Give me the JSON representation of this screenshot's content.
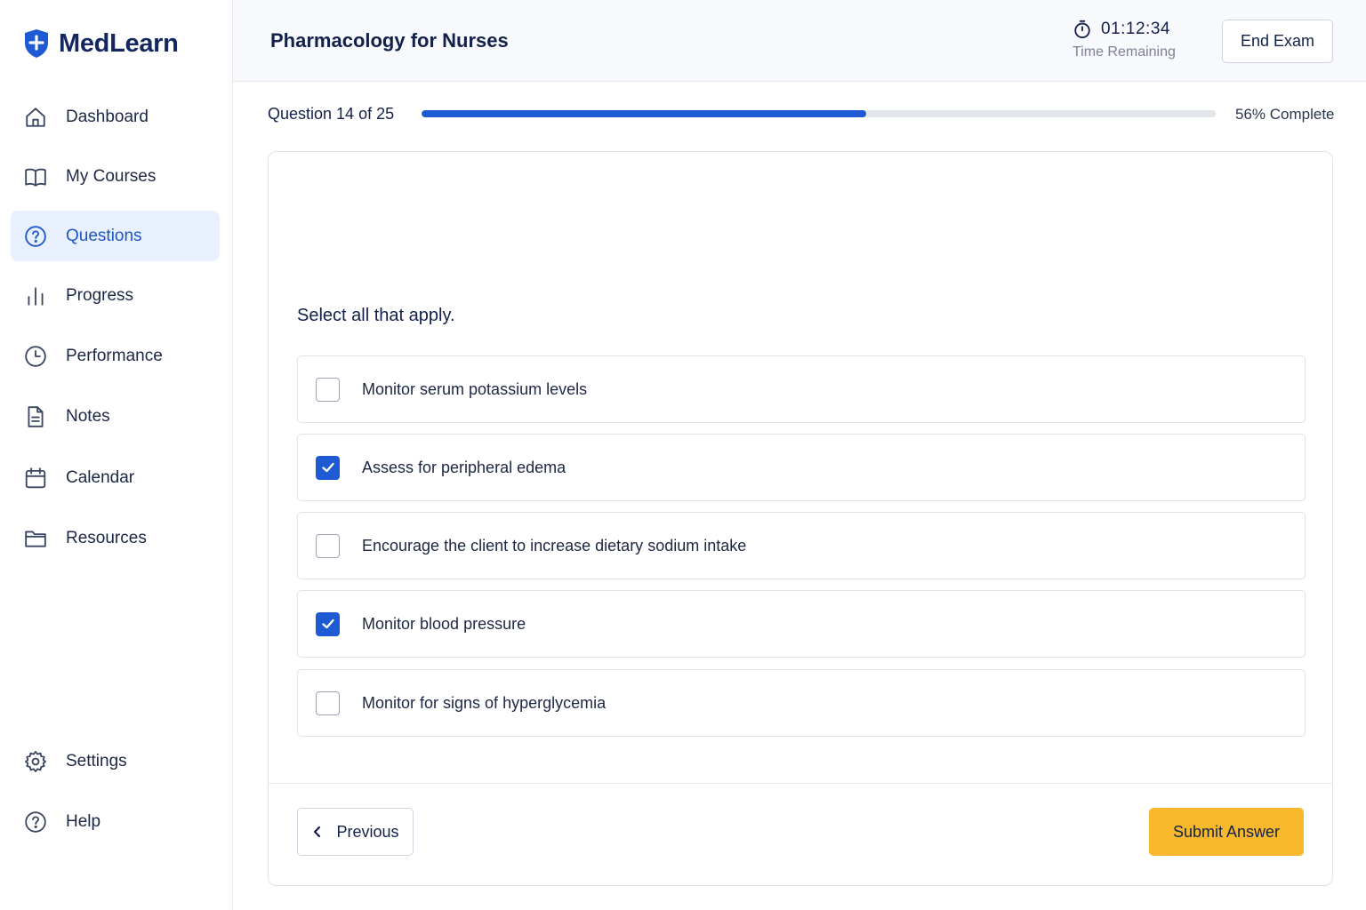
{
  "app": {
    "name": "MedLearn",
    "brand_color": "#1d5ad4"
  },
  "sidebar": {
    "items": [
      {
        "label": "Dashboard",
        "icon": "home-icon",
        "active": false
      },
      {
        "label": "My Courses",
        "icon": "book-icon",
        "active": false
      },
      {
        "label": "Questions",
        "icon": "question-circle-icon",
        "active": true
      },
      {
        "label": "Progress",
        "icon": "bar-chart-icon",
        "active": false
      },
      {
        "label": "Performance",
        "icon": "clock-icon",
        "active": false
      },
      {
        "label": "Notes",
        "icon": "document-icon",
        "active": false
      },
      {
        "label": "Calendar",
        "icon": "calendar-icon",
        "active": false
      },
      {
        "label": "Resources",
        "icon": "folder-icon",
        "active": false
      }
    ],
    "bottom_items": [
      {
        "label": "Settings",
        "icon": "gear-icon"
      },
      {
        "label": "Help",
        "icon": "help-circle-icon"
      }
    ]
  },
  "header": {
    "title": "Pharmacology for Nurses",
    "timer": {
      "value": "01:12:34",
      "label": "Time Remaining"
    },
    "end_exam_label": "End Exam"
  },
  "progress": {
    "question_label": "Question 14 of 25",
    "percent": 56,
    "percent_label": "56% Complete"
  },
  "question": {
    "instruction": "Select all that apply.",
    "options": [
      {
        "label": "Monitor serum potassium levels",
        "checked": false
      },
      {
        "label": "Assess for peripheral edema",
        "checked": true
      },
      {
        "label": "Encourage the client to increase dietary sodium intake",
        "checked": false
      },
      {
        "label": "Monitor blood pressure",
        "checked": true
      },
      {
        "label": "Monitor for signs of hyperglycemia",
        "checked": false
      }
    ]
  },
  "footer": {
    "previous_label": "Previous",
    "submit_label": "Submit Answer",
    "submit_color": "#f7b92b"
  }
}
